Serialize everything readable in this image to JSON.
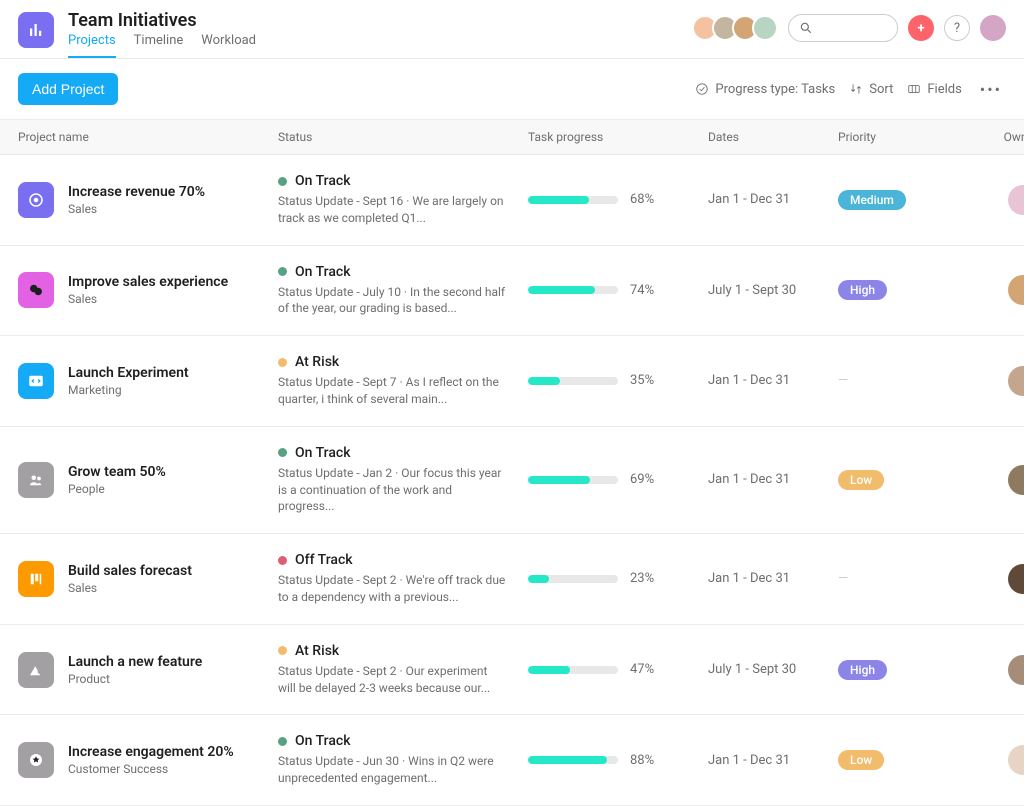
{
  "header": {
    "title": "Team Initiatives",
    "tabs": [
      {
        "label": "Projects",
        "active": true
      },
      {
        "label": "Timeline",
        "active": false
      },
      {
        "label": "Workload",
        "active": false
      }
    ],
    "teamAvatars": [
      {
        "bg": "#f4c2a1"
      },
      {
        "bg": "#c4b5a0"
      },
      {
        "bg": "#d4a574"
      },
      {
        "bg": "#b8d4c2"
      }
    ],
    "currentUser": {
      "bg": "#d4a5c4"
    }
  },
  "toolbar": {
    "addProject": "Add Project",
    "progressType": "Progress type: Tasks",
    "sort": "Sort",
    "fields": "Fields"
  },
  "columns": {
    "projectName": "Project name",
    "status": "Status",
    "taskProgress": "Task progress",
    "dates": "Dates",
    "priority": "Priority",
    "owner": "Owner"
  },
  "statusColors": {
    "On Track": "#58a182",
    "At Risk": "#f1bd6c",
    "Off Track": "#de5f73"
  },
  "progressColors": {
    "On Track": "#25e8c8",
    "At Risk": "#25e8c8",
    "Off Track": "#25e8c8"
  },
  "priorityColors": {
    "Medium": "#4ab4d9",
    "High": "#8d84e8",
    "Low": "#f1bd6c"
  },
  "rows": [
    {
      "icon": {
        "bg": "#7a6ff0",
        "glyph": "target"
      },
      "name": "Increase revenue 70%",
      "team": "Sales",
      "status": "On Track",
      "update": "Status Update - Sept 16 · We are largely on track as we completed Q1...",
      "progress": 68,
      "dates": "Jan 1 - Dec 31",
      "priority": "Medium",
      "owner": {
        "bg": "#e8c4d4"
      }
    },
    {
      "icon": {
        "bg": "#e362e3",
        "glyph": "chat"
      },
      "name": "Improve sales experience",
      "team": "Sales",
      "status": "On Track",
      "update": "Status Update - July 10 · In the second half of the year, our grading is based...",
      "progress": 74,
      "dates": "July 1 - Sept 30",
      "priority": "High",
      "owner": {
        "bg": "#d4a574"
      }
    },
    {
      "icon": {
        "bg": "#14aaf5",
        "glyph": "code"
      },
      "name": "Launch Experiment",
      "team": "Marketing",
      "status": "At Risk",
      "update": "Status Update - Sept 7 · As I reflect on the quarter, i think of several main...",
      "progress": 35,
      "dates": "Jan 1 - Dec 31",
      "priority": null,
      "owner": {
        "bg": "#c4a58d"
      }
    },
    {
      "icon": {
        "bg": "#a2a0a2",
        "glyph": "people"
      },
      "name": "Grow team 50%",
      "team": "People",
      "status": "On Track",
      "update": "Status Update - Jan 2 · Our focus this year is a continuation of the work and progress...",
      "progress": 69,
      "dates": "Jan 1 - Dec 31",
      "priority": "Low",
      "owner": {
        "bg": "#8d7a5f"
      }
    },
    {
      "icon": {
        "bg": "#fd9a00",
        "glyph": "board"
      },
      "name": "Build sales forecast",
      "team": "Sales",
      "status": "Off Track",
      "update": "Status Update - Sept 2 · We're off track due to a dependency with a previous...",
      "progress": 23,
      "dates": "Jan 1 - Dec 31",
      "priority": null,
      "owner": {
        "bg": "#5f4a3a"
      }
    },
    {
      "icon": {
        "bg": "#a2a0a2",
        "glyph": "mountain"
      },
      "name": "Launch a new feature",
      "team": "Product",
      "status": "At Risk",
      "update": "Status Update - Sept 2 · Our experiment will be delayed 2-3 weeks because our...",
      "progress": 47,
      "dates": "July 1 - Sept 30",
      "priority": "High",
      "owner": {
        "bg": "#a58d7a"
      }
    },
    {
      "icon": {
        "bg": "#a2a0a2",
        "glyph": "star"
      },
      "name": "Increase engagement 20%",
      "team": "Customer Success",
      "status": "On Track",
      "update": "Status Update - Jun 30 · Wins in Q2 were unprecedented engagement...",
      "progress": 88,
      "dates": "Jan 1 - Dec 31",
      "priority": "Low",
      "owner": {
        "bg": "#e8d4c4"
      }
    }
  ]
}
